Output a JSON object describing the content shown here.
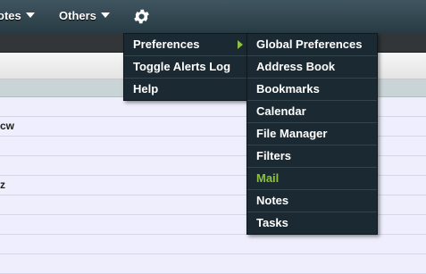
{
  "topbar": {
    "nav_items": [
      {
        "label": "otes"
      },
      {
        "label": "Others"
      }
    ],
    "gear_icon": "gear-icon"
  },
  "list": {
    "rows": [
      "",
      "cw",
      "",
      "",
      "z",
      "",
      "",
      "",
      ""
    ]
  },
  "main_menu": {
    "items": [
      {
        "label": "Preferences",
        "has_submenu": true
      },
      {
        "label": "Toggle Alerts Log"
      },
      {
        "label": "Help"
      }
    ]
  },
  "preferences_submenu": {
    "items": [
      {
        "label": "Global Preferences"
      },
      {
        "label": "Address Book"
      },
      {
        "label": "Bookmarks"
      },
      {
        "label": "Calendar"
      },
      {
        "label": "File Manager"
      },
      {
        "label": "Filters"
      },
      {
        "label": "Mail",
        "active": true
      },
      {
        "label": "Notes"
      },
      {
        "label": "Tasks"
      }
    ]
  },
  "colors": {
    "active_menu_text": "#8cc23d",
    "menu_background": "#1b2a32",
    "topbar": "#2f434d"
  }
}
